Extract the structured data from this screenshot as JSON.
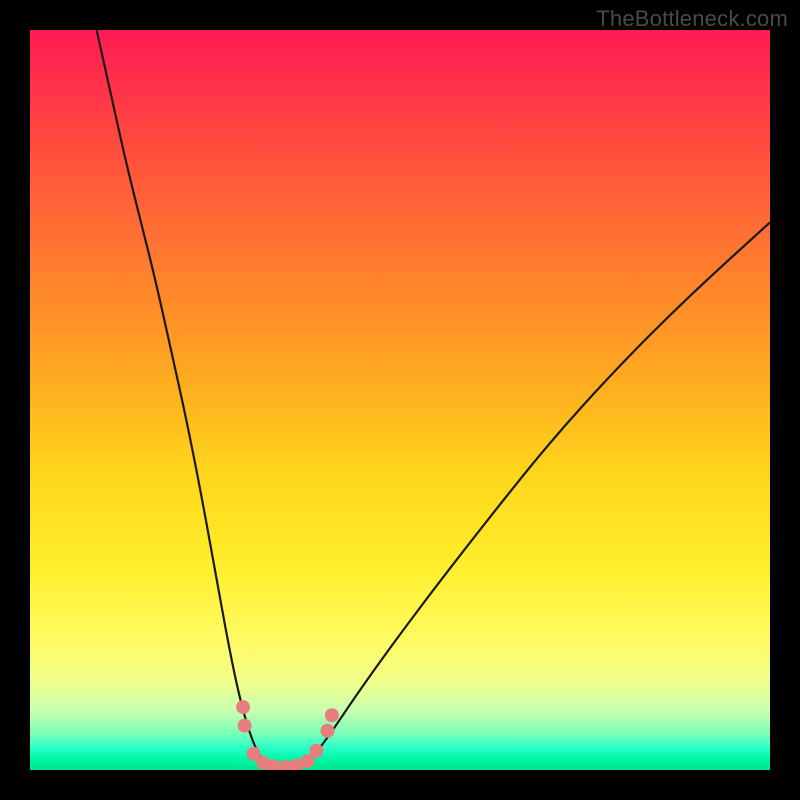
{
  "watermark": "TheBottleneck.com",
  "colors": {
    "frame": "#000000",
    "curve_stroke": "#1a1a1a",
    "marker_fill": "#e77d7d",
    "marker_stroke": "#e77d7d"
  },
  "chart_data": {
    "type": "line",
    "title": "",
    "xlabel": "",
    "ylabel": "",
    "xlim": [
      0,
      100
    ],
    "ylim": [
      0,
      100
    ],
    "grid": false,
    "legend": false,
    "series": [
      {
        "name": "bottleneck-curve-left",
        "x": [
          9,
          11,
          13,
          15,
          17,
          19,
          21,
          23,
          25,
          27,
          28.5,
          30,
          31.5
        ],
        "y": [
          100,
          91,
          82,
          74,
          66,
          57,
          48,
          38,
          27,
          16,
          9,
          4,
          1
        ]
      },
      {
        "name": "bottleneck-curve-bottom",
        "x": [
          31.5,
          33,
          34.5,
          36,
          37.5
        ],
        "y": [
          1,
          0.3,
          0.2,
          0.3,
          1
        ]
      },
      {
        "name": "bottleneck-curve-right",
        "x": [
          37.5,
          40,
          44,
          49,
          55,
          62,
          70,
          79,
          89,
          100
        ],
        "y": [
          1,
          4,
          10,
          17,
          25,
          34,
          44,
          54,
          64,
          74
        ]
      }
    ],
    "markers": [
      {
        "x": 28.8,
        "y": 8.5
      },
      {
        "x": 29.0,
        "y": 6.0
      },
      {
        "x": 30.2,
        "y": 2.2
      },
      {
        "x": 31.5,
        "y": 1.0
      },
      {
        "x": 32.8,
        "y": 0.5
      },
      {
        "x": 34.5,
        "y": 0.4
      },
      {
        "x": 36.0,
        "y": 0.6
      },
      {
        "x": 37.5,
        "y": 1.2
      },
      {
        "x": 38.7,
        "y": 2.6
      },
      {
        "x": 40.2,
        "y": 5.3
      },
      {
        "x": 40.8,
        "y": 7.4
      }
    ]
  }
}
